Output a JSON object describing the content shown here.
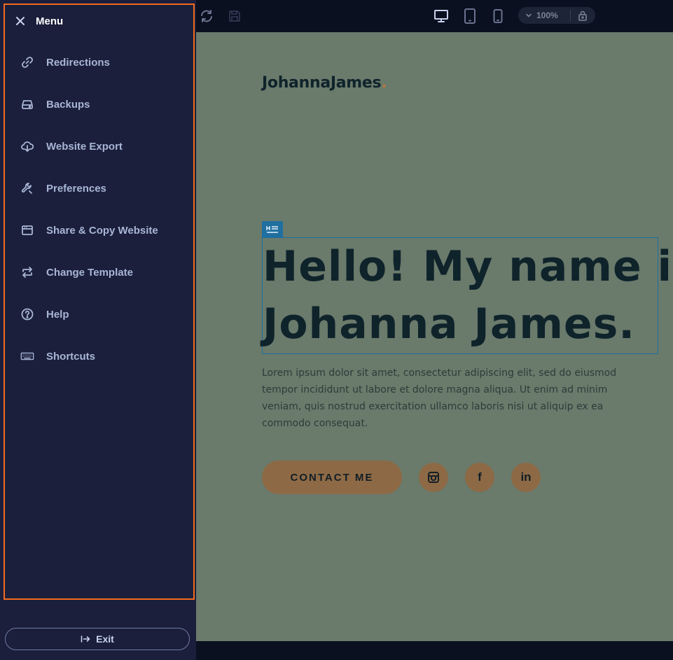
{
  "menu": {
    "title": "Menu",
    "items": [
      {
        "label": "Redirections",
        "icon": "link-icon"
      },
      {
        "label": "Backups",
        "icon": "drive-icon"
      },
      {
        "label": "Website Export",
        "icon": "cloud-download-icon"
      },
      {
        "label": "Preferences",
        "icon": "wrench-icon"
      },
      {
        "label": "Share & Copy Website",
        "icon": "browser-window-icon"
      },
      {
        "label": "Change Template",
        "icon": "swap-arrows-icon"
      },
      {
        "label": "Help",
        "icon": "question-circle-icon"
      },
      {
        "label": "Shortcuts",
        "icon": "keyboard-icon"
      }
    ],
    "exit_label": "Exit"
  },
  "toolbar": {
    "zoom": "100%"
  },
  "site": {
    "logo": "JohannaJames",
    "logo_dot": ".",
    "heading_tag": "H",
    "heading_line1": "Hello! My name is",
    "heading_line2": "Johanna James.",
    "body": "Lorem ipsum dolor sit amet, consectetur adipiscing elit, sed do eiusmod tempor incididunt ut labore et dolore magna aliqua. Ut enim ad minim veniam, quis nostrud exercitation ullamco laboris nisi ut aliquip ex ea commodo consequat.",
    "cta": "CONTACT ME",
    "social": {
      "facebook": "f",
      "linkedin": "in"
    }
  },
  "colors": {
    "sidebar_bg": "#1b1f3b",
    "highlight_border": "#f26b1d",
    "canvas_bg": "#6a7a6b",
    "accent_brown": "#8d6a45",
    "selection_blue": "#1f6fa0",
    "text_dark": "#0f232b"
  }
}
